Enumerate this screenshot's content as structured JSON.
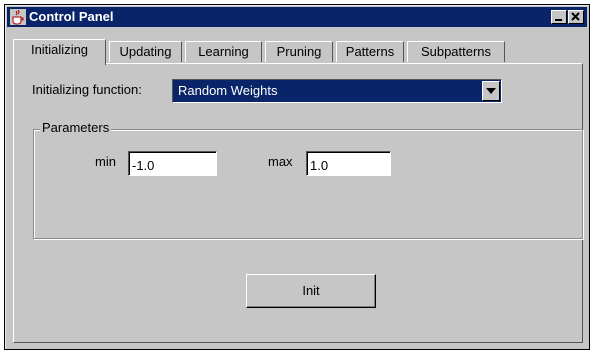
{
  "window": {
    "title": "Control Panel"
  },
  "tabs": [
    {
      "label": "Initializing",
      "active": true
    },
    {
      "label": "Updating",
      "active": false
    },
    {
      "label": "Learning",
      "active": false
    },
    {
      "label": "Pruning",
      "active": false
    },
    {
      "label": "Patterns",
      "active": false
    },
    {
      "label": "Subpatterns",
      "active": false
    }
  ],
  "init_function": {
    "label": "Initializing function:",
    "selected": "Random Weights"
  },
  "parameters": {
    "title": "Parameters",
    "min_label": "min",
    "min_value": "-1.0",
    "max_label": "max",
    "max_value": "1.0"
  },
  "actions": {
    "init_label": "Init"
  },
  "colors": {
    "titlebar": "#0a246a",
    "window_bg": "#c6c6c6",
    "selection": "#0a246a"
  },
  "icons": {
    "title_icon": "java-cup-icon",
    "minimize": "minimize-icon",
    "close": "close-icon",
    "dropdown": "chevron-down-icon"
  }
}
